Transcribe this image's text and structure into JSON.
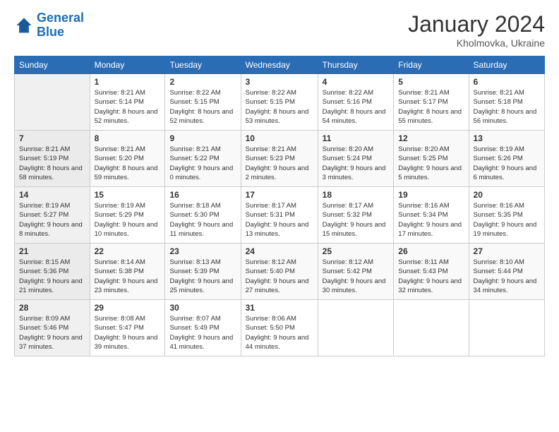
{
  "header": {
    "logo_line1": "General",
    "logo_line2": "Blue",
    "month_title": "January 2024",
    "location": "Kholmovka, Ukraine"
  },
  "days_of_week": [
    "Sunday",
    "Monday",
    "Tuesday",
    "Wednesday",
    "Thursday",
    "Friday",
    "Saturday"
  ],
  "weeks": [
    [
      {
        "num": "",
        "sunrise": "",
        "sunset": "",
        "daylight": ""
      },
      {
        "num": "1",
        "sunrise": "Sunrise: 8:21 AM",
        "sunset": "Sunset: 5:14 PM",
        "daylight": "Daylight: 8 hours and 52 minutes."
      },
      {
        "num": "2",
        "sunrise": "Sunrise: 8:22 AM",
        "sunset": "Sunset: 5:15 PM",
        "daylight": "Daylight: 8 hours and 52 minutes."
      },
      {
        "num": "3",
        "sunrise": "Sunrise: 8:22 AM",
        "sunset": "Sunset: 5:15 PM",
        "daylight": "Daylight: 8 hours and 53 minutes."
      },
      {
        "num": "4",
        "sunrise": "Sunrise: 8:22 AM",
        "sunset": "Sunset: 5:16 PM",
        "daylight": "Daylight: 8 hours and 54 minutes."
      },
      {
        "num": "5",
        "sunrise": "Sunrise: 8:21 AM",
        "sunset": "Sunset: 5:17 PM",
        "daylight": "Daylight: 8 hours and 55 minutes."
      },
      {
        "num": "6",
        "sunrise": "Sunrise: 8:21 AM",
        "sunset": "Sunset: 5:18 PM",
        "daylight": "Daylight: 8 hours and 56 minutes."
      }
    ],
    [
      {
        "num": "7",
        "sunrise": "Sunrise: 8:21 AM",
        "sunset": "Sunset: 5:19 PM",
        "daylight": "Daylight: 8 hours and 58 minutes."
      },
      {
        "num": "8",
        "sunrise": "Sunrise: 8:21 AM",
        "sunset": "Sunset: 5:20 PM",
        "daylight": "Daylight: 8 hours and 59 minutes."
      },
      {
        "num": "9",
        "sunrise": "Sunrise: 8:21 AM",
        "sunset": "Sunset: 5:22 PM",
        "daylight": "Daylight: 9 hours and 0 minutes."
      },
      {
        "num": "10",
        "sunrise": "Sunrise: 8:21 AM",
        "sunset": "Sunset: 5:23 PM",
        "daylight": "Daylight: 9 hours and 2 minutes."
      },
      {
        "num": "11",
        "sunrise": "Sunrise: 8:20 AM",
        "sunset": "Sunset: 5:24 PM",
        "daylight": "Daylight: 9 hours and 3 minutes."
      },
      {
        "num": "12",
        "sunrise": "Sunrise: 8:20 AM",
        "sunset": "Sunset: 5:25 PM",
        "daylight": "Daylight: 9 hours and 5 minutes."
      },
      {
        "num": "13",
        "sunrise": "Sunrise: 8:19 AM",
        "sunset": "Sunset: 5:26 PM",
        "daylight": "Daylight: 9 hours and 6 minutes."
      }
    ],
    [
      {
        "num": "14",
        "sunrise": "Sunrise: 8:19 AM",
        "sunset": "Sunset: 5:27 PM",
        "daylight": "Daylight: 9 hours and 8 minutes."
      },
      {
        "num": "15",
        "sunrise": "Sunrise: 8:19 AM",
        "sunset": "Sunset: 5:29 PM",
        "daylight": "Daylight: 9 hours and 10 minutes."
      },
      {
        "num": "16",
        "sunrise": "Sunrise: 8:18 AM",
        "sunset": "Sunset: 5:30 PM",
        "daylight": "Daylight: 9 hours and 11 minutes."
      },
      {
        "num": "17",
        "sunrise": "Sunrise: 8:17 AM",
        "sunset": "Sunset: 5:31 PM",
        "daylight": "Daylight: 9 hours and 13 minutes."
      },
      {
        "num": "18",
        "sunrise": "Sunrise: 8:17 AM",
        "sunset": "Sunset: 5:32 PM",
        "daylight": "Daylight: 9 hours and 15 minutes."
      },
      {
        "num": "19",
        "sunrise": "Sunrise: 8:16 AM",
        "sunset": "Sunset: 5:34 PM",
        "daylight": "Daylight: 9 hours and 17 minutes."
      },
      {
        "num": "20",
        "sunrise": "Sunrise: 8:16 AM",
        "sunset": "Sunset: 5:35 PM",
        "daylight": "Daylight: 9 hours and 19 minutes."
      }
    ],
    [
      {
        "num": "21",
        "sunrise": "Sunrise: 8:15 AM",
        "sunset": "Sunset: 5:36 PM",
        "daylight": "Daylight: 9 hours and 21 minutes."
      },
      {
        "num": "22",
        "sunrise": "Sunrise: 8:14 AM",
        "sunset": "Sunset: 5:38 PM",
        "daylight": "Daylight: 9 hours and 23 minutes."
      },
      {
        "num": "23",
        "sunrise": "Sunrise: 8:13 AM",
        "sunset": "Sunset: 5:39 PM",
        "daylight": "Daylight: 9 hours and 25 minutes."
      },
      {
        "num": "24",
        "sunrise": "Sunrise: 8:12 AM",
        "sunset": "Sunset: 5:40 PM",
        "daylight": "Daylight: 9 hours and 27 minutes."
      },
      {
        "num": "25",
        "sunrise": "Sunrise: 8:12 AM",
        "sunset": "Sunset: 5:42 PM",
        "daylight": "Daylight: 9 hours and 30 minutes."
      },
      {
        "num": "26",
        "sunrise": "Sunrise: 8:11 AM",
        "sunset": "Sunset: 5:43 PM",
        "daylight": "Daylight: 9 hours and 32 minutes."
      },
      {
        "num": "27",
        "sunrise": "Sunrise: 8:10 AM",
        "sunset": "Sunset: 5:44 PM",
        "daylight": "Daylight: 9 hours and 34 minutes."
      }
    ],
    [
      {
        "num": "28",
        "sunrise": "Sunrise: 8:09 AM",
        "sunset": "Sunset: 5:46 PM",
        "daylight": "Daylight: 9 hours and 37 minutes."
      },
      {
        "num": "29",
        "sunrise": "Sunrise: 8:08 AM",
        "sunset": "Sunset: 5:47 PM",
        "daylight": "Daylight: 9 hours and 39 minutes."
      },
      {
        "num": "30",
        "sunrise": "Sunrise: 8:07 AM",
        "sunset": "Sunset: 5:49 PM",
        "daylight": "Daylight: 9 hours and 41 minutes."
      },
      {
        "num": "31",
        "sunrise": "Sunrise: 8:06 AM",
        "sunset": "Sunset: 5:50 PM",
        "daylight": "Daylight: 9 hours and 44 minutes."
      },
      {
        "num": "",
        "sunrise": "",
        "sunset": "",
        "daylight": ""
      },
      {
        "num": "",
        "sunrise": "",
        "sunset": "",
        "daylight": ""
      },
      {
        "num": "",
        "sunrise": "",
        "sunset": "",
        "daylight": ""
      }
    ]
  ]
}
